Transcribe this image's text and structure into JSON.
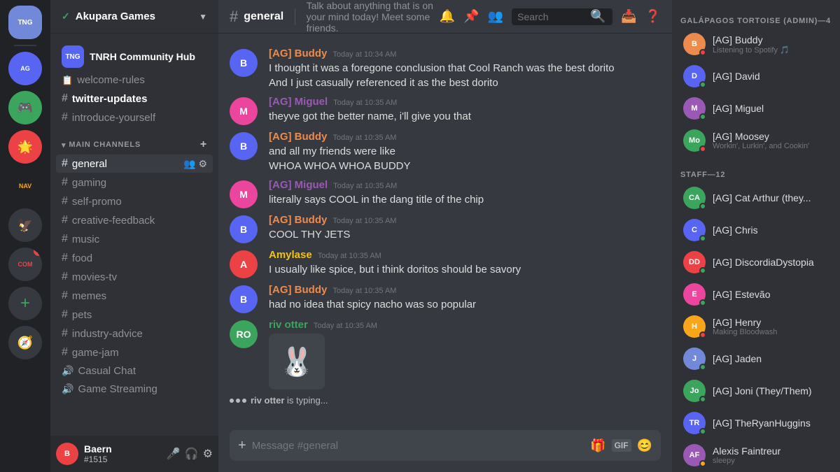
{
  "server_list": {
    "servers": [
      {
        "id": "tnrh",
        "label": "TNG",
        "color": "#5865f2",
        "active": false
      },
      {
        "id": "ag1",
        "label": "AG",
        "color": "#eb459e",
        "active": false
      },
      {
        "id": "ag2",
        "label": "",
        "color": "#3ba55d",
        "active": false
      },
      {
        "id": "ag3",
        "label": "",
        "color": "#faa61a",
        "active": false
      },
      {
        "id": "ag4",
        "label": "NAV",
        "color": "#36393f",
        "active": false
      },
      {
        "id": "ag5",
        "label": "",
        "color": "#7289da",
        "active": false
      },
      {
        "id": "ag6",
        "label": "COM",
        "color": "#ed4245",
        "active": false,
        "notif": 1
      }
    ],
    "add_label": "+",
    "explore_label": "🧭"
  },
  "sidebar": {
    "server_name": "Akupara Games",
    "server_hub": "TNRH Community Hub",
    "non_category_channels": [
      {
        "name": "welcome-rules",
        "type": "text",
        "icon": "📋"
      },
      {
        "name": "twitter-updates",
        "type": "text",
        "active": true
      },
      {
        "name": "introduce-yourself",
        "type": "text"
      }
    ],
    "category_name": "MAIN CHANNELS",
    "channels": [
      {
        "name": "general",
        "type": "text",
        "active": true
      },
      {
        "name": "gaming",
        "type": "text"
      },
      {
        "name": "self-promo",
        "type": "text"
      },
      {
        "name": "creative-feedback",
        "type": "text"
      },
      {
        "name": "music",
        "type": "text"
      },
      {
        "name": "food",
        "type": "text"
      },
      {
        "name": "movies-tv",
        "type": "text"
      },
      {
        "name": "memes",
        "type": "text"
      },
      {
        "name": "pets",
        "type": "text"
      },
      {
        "name": "industry-advice",
        "type": "text"
      },
      {
        "name": "game-jam",
        "type": "text"
      },
      {
        "name": "Casual Chat",
        "type": "voice"
      },
      {
        "name": "Game Streaming",
        "type": "voice"
      }
    ],
    "user": {
      "name": "Baern",
      "discriminator": "#1515",
      "avatar_text": "B",
      "avatar_color": "#ed4245"
    }
  },
  "chat": {
    "channel_name": "general",
    "channel_topic": "Talk about anything that is on your mind today! Meet some friends.",
    "search_placeholder": "Search",
    "input_placeholder": "Message #general",
    "messages": [
      {
        "id": "m1",
        "username": "[AG] Buddy",
        "user_class": "buddy",
        "timestamp": "Today at 10:34 AM",
        "lines": [
          "I thought it was a foregone conclusion that Cool Ranch was the best dorito",
          "And I just casually referenced it as the best dorito"
        ]
      },
      {
        "id": "m2",
        "username": "[AG] Miguel",
        "user_class": "miguel",
        "timestamp": "Today at 10:35 AM",
        "lines": [
          "theyve got the better name, i'll give you that"
        ]
      },
      {
        "id": "m3",
        "username": "[AG] Buddy",
        "user_class": "buddy",
        "timestamp": "Today at 10:35 AM",
        "lines": [
          "and all my friends were like",
          "WHOA WHOA WHOA BUDDY"
        ]
      },
      {
        "id": "m4",
        "username": "[AG] Miguel",
        "user_class": "miguel",
        "timestamp": "Today at 10:35 AM",
        "lines": [
          "literally says COOL in the dang title of the chip"
        ]
      },
      {
        "id": "m5",
        "username": "[AG] Buddy",
        "user_class": "buddy",
        "timestamp": "Today at 10:35 AM",
        "lines": [
          "COOL THY JETS"
        ]
      },
      {
        "id": "m6",
        "username": "Amylase",
        "user_class": "amylase",
        "timestamp": "Today at 10:35 AM",
        "lines": [
          "I usually like spice, but i think doritos should be savory"
        ]
      },
      {
        "id": "m7",
        "username": "[AG] Buddy",
        "user_class": "buddy",
        "timestamp": "Today at 10:35 AM",
        "lines": [
          "had no idea that spicy nacho was so popular"
        ]
      },
      {
        "id": "m8",
        "username": "riv otter",
        "user_class": "riv",
        "timestamp": "Today at 10:35 AM",
        "lines": [],
        "has_sticker": true
      }
    ],
    "typing_user": "riv otter",
    "typing_text": "is typing..."
  },
  "members": {
    "categories": [
      {
        "name": "GALÁPAGOS TORTOISE (ADMIN)—4",
        "members": [
          {
            "name": "[AG] Buddy",
            "status": "dnd",
            "sub": "Listening to Spotify 🎵",
            "color": "#ed8b4d",
            "initials": "B"
          },
          {
            "name": "[AG] David",
            "status": "online",
            "sub": "",
            "color": "#5865f2",
            "initials": "D"
          },
          {
            "name": "[AG] Miguel",
            "status": "online",
            "sub": "",
            "color": "#9b59b6",
            "initials": "M"
          },
          {
            "name": "[AG] Moosey",
            "status": "dnd",
            "sub": "Workin', Lurkin', and Cookin'",
            "color": "#3ba55d",
            "initials": "Mo"
          }
        ]
      },
      {
        "name": "STAFF—12",
        "members": [
          {
            "name": "[AG] Cat Arthur (they...",
            "status": "online",
            "sub": "",
            "color": "#3ba55d",
            "initials": "CA"
          },
          {
            "name": "[AG] Chris",
            "status": "online",
            "sub": "",
            "color": "#5865f2",
            "initials": "C"
          },
          {
            "name": "[AG] DiscordiaDystopia",
            "status": "online",
            "sub": "",
            "color": "#ed4245",
            "initials": "DD"
          },
          {
            "name": "[AG] Estevão",
            "status": "online",
            "sub": "",
            "color": "#eb459e",
            "initials": "E"
          },
          {
            "name": "[AG] Henry",
            "status": "dnd",
            "sub": "Making Bloodwash",
            "color": "#faa61a",
            "initials": "H"
          },
          {
            "name": "[AG] Jaden",
            "status": "online",
            "sub": "",
            "color": "#7289da",
            "initials": "J"
          },
          {
            "name": "[AG] Joni (They/Them)",
            "status": "online",
            "sub": "",
            "color": "#3ba55d",
            "initials": "Jo"
          },
          {
            "name": "[AG] TheRyanHuggins",
            "status": "online",
            "sub": "",
            "color": "#5865f2",
            "initials": "TR"
          },
          {
            "name": "Alexis Faintreur",
            "status": "idle",
            "sub": "sleepy",
            "color": "#9b59b6",
            "initials": "AF"
          }
        ]
      }
    ]
  }
}
